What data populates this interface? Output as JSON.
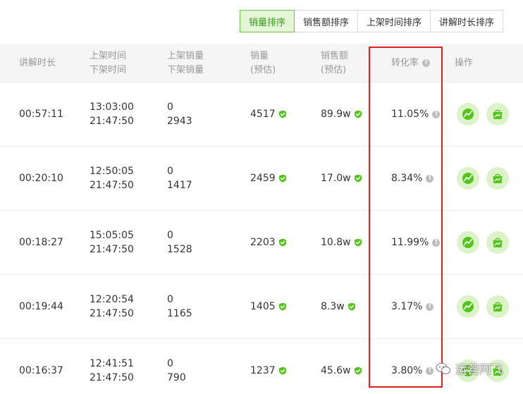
{
  "sort_tabs": [
    {
      "label": "销量排序",
      "active": true
    },
    {
      "label": "销售额排序",
      "active": false
    },
    {
      "label": "上架时间排序",
      "active": false
    },
    {
      "label": "讲解时长排序",
      "active": false
    }
  ],
  "columns": {
    "duration": "讲解时长",
    "listed_time": "上架时间",
    "delisted_time": "下架时间",
    "listed_sales": "上架销量",
    "delisted_sales": "下架销量",
    "sales": "销量",
    "sales_est": "(预估)",
    "revenue": "销售额",
    "revenue_est": "(预估)",
    "conversion": "转化率",
    "actions": "操作"
  },
  "rows": [
    {
      "duration": "00:57:11",
      "listed_time": "13:03:00",
      "delisted_time": "21:47:50",
      "listed_sales": "0",
      "delisted_sales": "2943",
      "sales": "4517",
      "revenue": "89.9w",
      "conversion": "11.05%"
    },
    {
      "duration": "00:20:10",
      "listed_time": "12:50:05",
      "delisted_time": "21:47:50",
      "listed_sales": "0",
      "delisted_sales": "1417",
      "sales": "2459",
      "revenue": "17.0w",
      "conversion": "8.34%"
    },
    {
      "duration": "00:18:27",
      "listed_time": "15:05:05",
      "delisted_time": "21:47:50",
      "listed_sales": "0",
      "delisted_sales": "1528",
      "sales": "2203",
      "revenue": "10.8w",
      "conversion": "11.99%"
    },
    {
      "duration": "00:19:44",
      "listed_time": "12:20:54",
      "delisted_time": "21:47:50",
      "listed_sales": "0",
      "delisted_sales": "1165",
      "sales": "1405",
      "revenue": "8.3w",
      "conversion": "3.17%"
    },
    {
      "duration": "00:16:37",
      "listed_time": "12:41:51",
      "delisted_time": "21:47:50",
      "listed_sales": "0",
      "delisted_sales": "790",
      "sales": "1237",
      "revenue": "45.6w",
      "conversion": "3.80%"
    }
  ],
  "icons": {
    "verified": "green-check-shield-icon",
    "info": "info-icon",
    "trend": "trend-chart-icon",
    "bag": "shopping-bag-icon"
  },
  "colors": {
    "accent_green": "#52c41a",
    "active_tab_bg": "#e3f6d5",
    "highlight_red": "#e02020"
  },
  "watermark": "运营阿飞"
}
